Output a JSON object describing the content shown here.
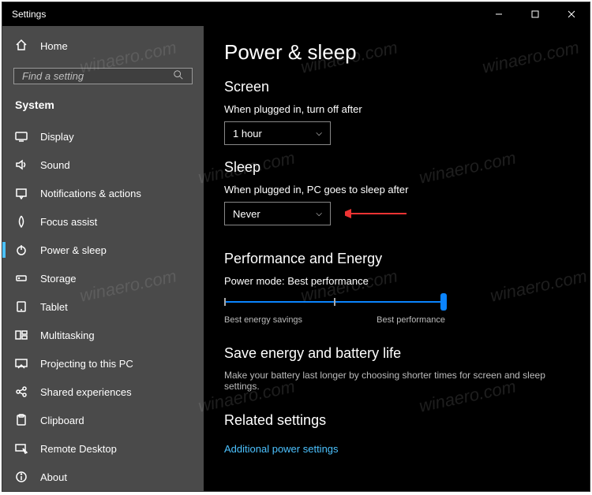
{
  "window": {
    "title": "Settings"
  },
  "sidebar": {
    "home": "Home",
    "search_placeholder": "Find a setting",
    "category": "System",
    "items": [
      {
        "label": "Display"
      },
      {
        "label": "Sound"
      },
      {
        "label": "Notifications & actions"
      },
      {
        "label": "Focus assist"
      },
      {
        "label": "Power & sleep"
      },
      {
        "label": "Storage"
      },
      {
        "label": "Tablet"
      },
      {
        "label": "Multitasking"
      },
      {
        "label": "Projecting to this PC"
      },
      {
        "label": "Shared experiences"
      },
      {
        "label": "Clipboard"
      },
      {
        "label": "Remote Desktop"
      },
      {
        "label": "About"
      }
    ]
  },
  "main": {
    "title": "Power & sleep",
    "screen": {
      "heading": "Screen",
      "label": "When plugged in, turn off after",
      "value": "1 hour"
    },
    "sleep": {
      "heading": "Sleep",
      "label": "When plugged in, PC goes to sleep after",
      "value": "Never"
    },
    "perf": {
      "heading": "Performance and Energy",
      "mode_label": "Power mode: Best performance",
      "left_label": "Best energy savings",
      "right_label": "Best performance"
    },
    "save": {
      "heading": "Save energy and battery life",
      "desc": "Make your battery last longer by choosing shorter times for screen and sleep settings."
    },
    "related": {
      "heading": "Related settings",
      "link": "Additional power settings"
    }
  }
}
